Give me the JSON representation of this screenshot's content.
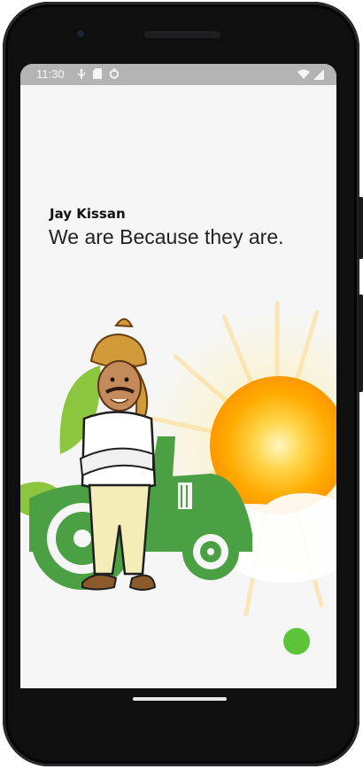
{
  "status": {
    "time": "11:30"
  },
  "app": {
    "brand": "Jay Kissan",
    "tagline": "We are Because they are."
  },
  "colors": {
    "accent": "#5cc43a",
    "tractor": "#4aa043",
    "leaf": "#8cc63f",
    "sun": "#ffb300"
  }
}
